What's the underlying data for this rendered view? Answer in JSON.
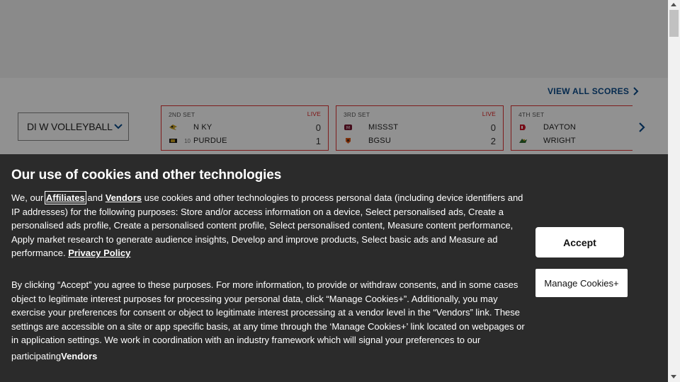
{
  "scores_header": {
    "view_all_label": "VIEW ALL SCORES"
  },
  "sport_select": {
    "value": "DI W VOLLEYBALL"
  },
  "games": [
    {
      "period": "2ND SET",
      "status": "LIVE",
      "teams": [
        {
          "rank": "",
          "name": "N KY",
          "score": "0"
        },
        {
          "rank": "10",
          "name": "PURDUE",
          "score": "1"
        }
      ]
    },
    {
      "period": "3RD SET",
      "status": "LIVE",
      "teams": [
        {
          "rank": "",
          "name": "MISSST",
          "score": "0"
        },
        {
          "rank": "",
          "name": "BGSU",
          "score": "2"
        }
      ]
    },
    {
      "period": "4TH SET",
      "status": "",
      "teams": [
        {
          "rank": "",
          "name": "DAYTON",
          "score": ""
        },
        {
          "rank": "",
          "name": "WRIGHT",
          "score": ""
        }
      ]
    }
  ],
  "cookie_banner": {
    "title": "Our use of cookies and other technologies",
    "p1_prefix": "We, our ",
    "affiliates_link": "Affiliates",
    "p1_and": " and ",
    "vendors_link": "Vendors",
    "p1_body": " use cookies and other technologies to process personal data (including device identifiers and IP addresses) for the following purposes: Store and/or access information on a device, Select personalised ads, Create a personalised ads profile, Create a personalised content profile, Select personalised content, Measure content performance, Apply market research to generate audience insights, Develop and improve products, Select basic ads and Measure ad performance. ",
    "privacy_link": "Privacy Policy",
    "p2": "By clicking “Accept” you agree to these purposes. For more information, to provide or withdraw consents, and in some cases object to legitimate interest purposes for processing your personal data, click “Manage Cookies+”. Additionally, you may exercise your preferences for consent or object to legitimate interest processing at a vendor level in the “Vendors” link. These settings are accessible on a site or app specific basis, at any time through the ‘Manage Cookies+’ link located on webpages or in application settings. We work in coordination with an industry framework which will signal your preferences to our",
    "p3_prefix": "participating",
    "p3_vendors": "Vendors",
    "accept_label": "Accept",
    "manage_label": "Manage Cookies+"
  },
  "colors": {
    "live_red": "#dd2222",
    "link_blue": "#0a4a8a",
    "banner_bg": "#2b2b2b"
  },
  "icons": [
    "chevron-right-icon",
    "chevron-down-icon",
    "team-logo-icon",
    "scroll-up-icon",
    "scroll-down-icon"
  ]
}
